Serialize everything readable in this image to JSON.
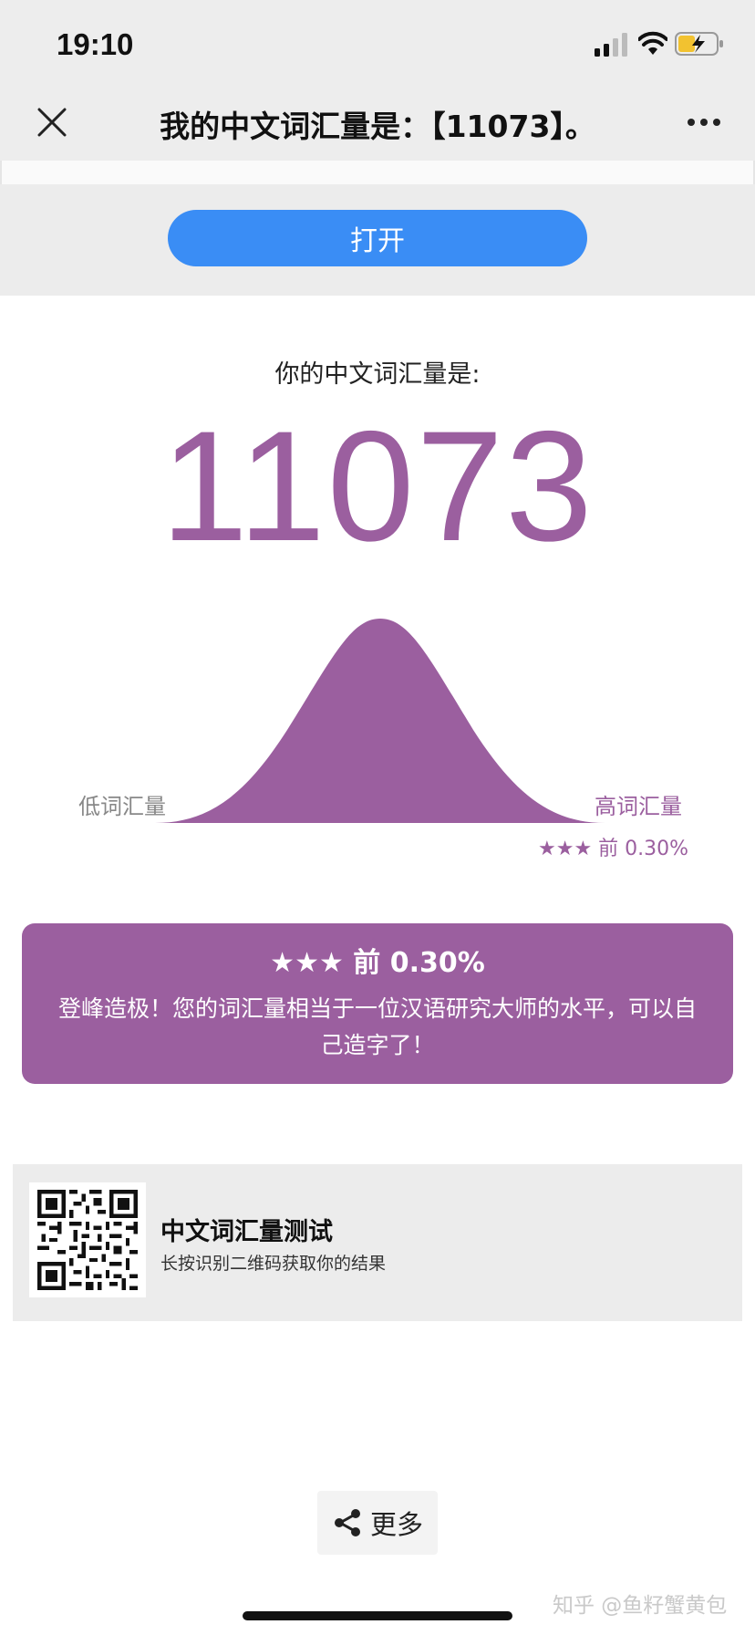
{
  "status_bar": {
    "time": "19:10"
  },
  "nav": {
    "title": "我的中文词汇量是：【11073】。",
    "close_icon": "close-icon",
    "more_icon": "more-dots-icon"
  },
  "banner": {
    "open_label": "打开",
    "button_color": "#3a8df5"
  },
  "result": {
    "label": "你的中文词汇量是:",
    "score": "11073",
    "accent_color": "#9b5f9f"
  },
  "distribution": {
    "low_label": "低词汇量",
    "high_label": "高词汇量",
    "rank_label": "★★★ 前 0.30%"
  },
  "verdict": {
    "rank": "★★★ 前 0.30%",
    "description": "登峰造极！您的词汇量相当于一位汉语研究大师的水平，可以自己造字了！"
  },
  "qr": {
    "title": "中文词汇量测试",
    "subtitle": "长按识别二维码获取你的结果"
  },
  "more": {
    "label": "更多"
  },
  "watermark": "知乎 @鱼籽蟹黄包"
}
